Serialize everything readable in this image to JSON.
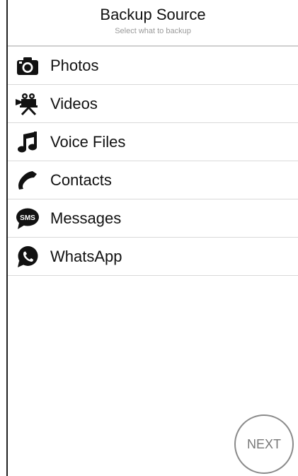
{
  "header": {
    "title": "Backup Source",
    "subtitle": "Select what to backup"
  },
  "items": [
    {
      "label": "Photos",
      "icon": "camera-icon"
    },
    {
      "label": "Videos",
      "icon": "video-camera-icon"
    },
    {
      "label": "Voice Files",
      "icon": "music-note-icon"
    },
    {
      "label": "Contacts",
      "icon": "phone-icon"
    },
    {
      "label": "Messages",
      "icon": "sms-icon"
    },
    {
      "label": "WhatsApp",
      "icon": "whatsapp-icon"
    }
  ],
  "footer": {
    "next_label": "NEXT"
  },
  "colors": {
    "text": "#111111",
    "subtitle": "#9a9a9a",
    "divider": "#d9d9d9",
    "next_border": "#8a8a8a",
    "next_text": "#777777"
  }
}
